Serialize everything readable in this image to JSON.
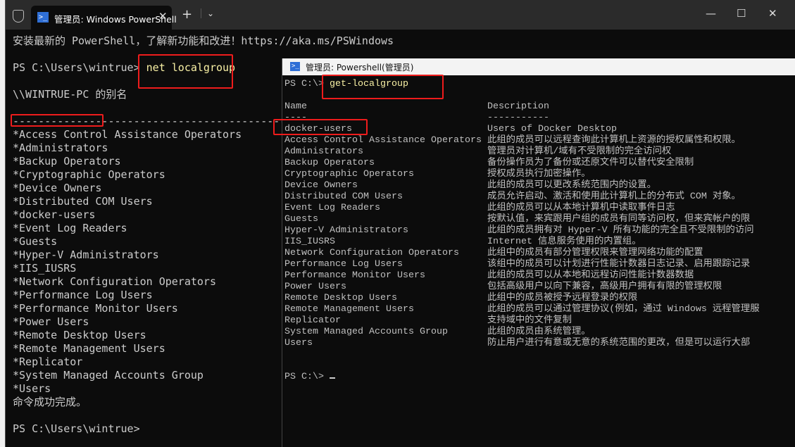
{
  "main_window": {
    "tab_title": "管理员: Windows PowerShell",
    "banner": "安装最新的 PowerShell，了解新功能和改进！https://aka.ms/PSWindows",
    "prompt1": "PS C:\\Users\\wintrue> ",
    "command": "net localgroup",
    "alias_header": "\\\\WINTRUE-PC 的别名",
    "separator": "-------------------------------------------------------------------------------",
    "groups": [
      "*Access Control Assistance Operators",
      "*Administrators",
      "*Backup Operators",
      "*Cryptographic Operators",
      "*Device Owners",
      "*Distributed COM Users",
      "*docker-users",
      "*Event Log Readers",
      "*Guests",
      "*Hyper-V Administrators",
      "*IIS_IUSRS",
      "*Network Configuration Operators",
      "*Performance Log Users",
      "*Performance Monitor Users",
      "*Power Users",
      "*Remote Desktop Users",
      "*Remote Management Users",
      "*Replicator",
      "*System Managed Accounts Group",
      "*Users"
    ],
    "success": "命令成功完成。",
    "prompt2": "PS C:\\Users\\wintrue>"
  },
  "overlay_window": {
    "title": "管理员: Powershell(管理员)",
    "prompt": "PS C:\\> ",
    "command": "get-localgroup",
    "col_name": "Name",
    "col_desc": "Description",
    "name_sep": "----",
    "desc_sep": "-----------",
    "rows": [
      {
        "name": "docker-users",
        "desc": "Users of Docker Desktop"
      },
      {
        "name": "Access Control Assistance Operators",
        "desc": "此组的成员可以远程查询此计算机上资源的授权属性和权限。"
      },
      {
        "name": "Administrators",
        "desc": "管理员对计算机/域有不受限制的完全访问权"
      },
      {
        "name": "Backup Operators",
        "desc": "备份操作员为了备份或还原文件可以替代安全限制"
      },
      {
        "name": "Cryptographic Operators",
        "desc": "授权成员执行加密操作。"
      },
      {
        "name": "Device Owners",
        "desc": "此组的成员可以更改系统范围内的设置。"
      },
      {
        "name": "Distributed COM Users",
        "desc": "成员允许启动、激活和使用此计算机上的分布式 COM 对象。"
      },
      {
        "name": "Event Log Readers",
        "desc": "此组的成员可以从本地计算机中读取事件日志"
      },
      {
        "name": "Guests",
        "desc": "按默认值，来宾跟用户组的成员有同等访问权，但来宾帐户的限"
      },
      {
        "name": "Hyper-V Administrators",
        "desc": "此组的成员拥有对 Hyper-V 所有功能的完全且不受限制的访问"
      },
      {
        "name": "IIS_IUSRS",
        "desc": "Internet 信息服务使用的内置组。"
      },
      {
        "name": "Network Configuration Operators",
        "desc": "此组中的成员有部分管理权限来管理网络功能的配置"
      },
      {
        "name": "Performance Log Users",
        "desc": "该组中的成员可以计划进行性能计数器日志记录、启用跟踪记录"
      },
      {
        "name": "Performance Monitor Users",
        "desc": "此组的成员可以从本地和远程访问性能计数器数据"
      },
      {
        "name": "Power Users",
        "desc": "包括高级用户以向下兼容，高级用户拥有有限的管理权限"
      },
      {
        "name": "Remote Desktop Users",
        "desc": "此组中的成员被授予远程登录的权限"
      },
      {
        "name": "Remote Management Users",
        "desc": "此组的成员可以通过管理协议(例如，通过 Windows 远程管理服"
      },
      {
        "name": "Replicator",
        "desc": "支持域中的文件复制"
      },
      {
        "name": "System Managed Accounts Group",
        "desc": "此组的成员由系统管理。"
      },
      {
        "name": "Users",
        "desc": "防止用户进行有意或无意的系统范围的更改，但是可以运行大部"
      }
    ],
    "prompt2": "PS C:\\> "
  },
  "colors": {
    "terminal_bg": "#0c0c0c",
    "command": "#f9f1a5",
    "highlight": "#ee1c1c"
  }
}
